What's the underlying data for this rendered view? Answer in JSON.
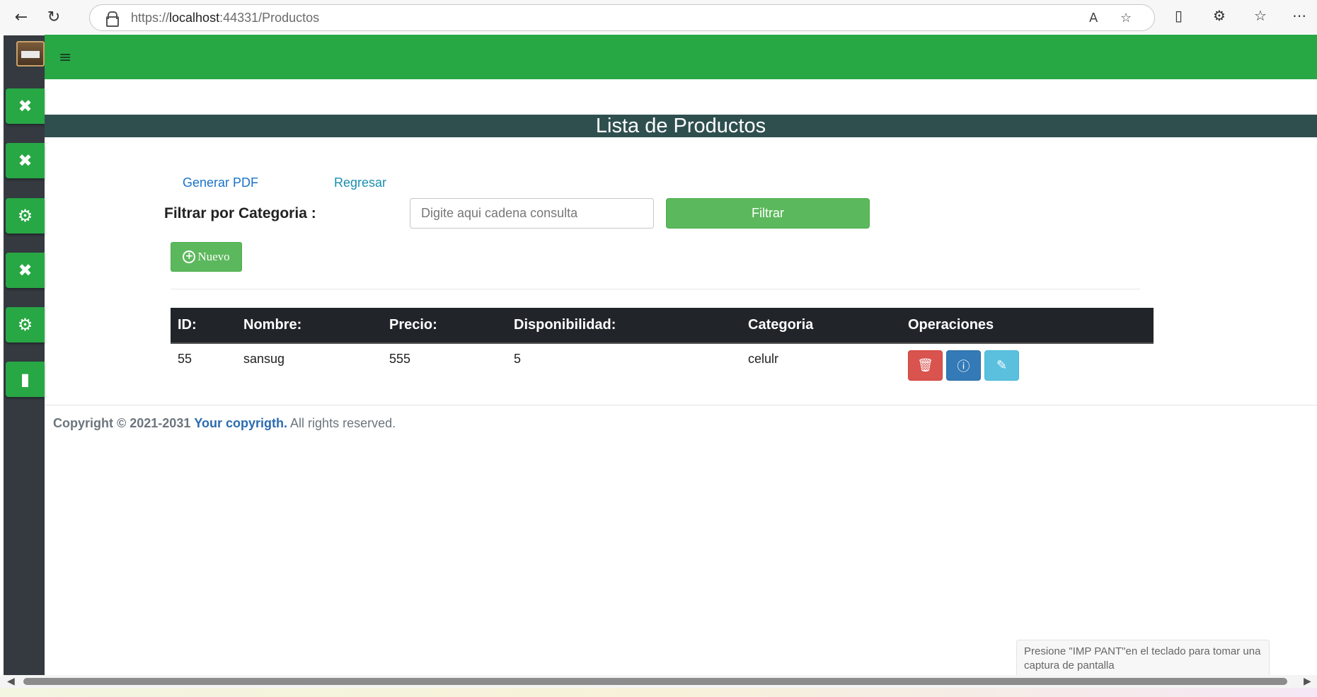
{
  "browser": {
    "url_prefix": "https://",
    "url_host": "localhost",
    "url_rest": ":44331/Productos",
    "icons": [
      "back-icon",
      "refresh-icon",
      "lock-icon",
      "read-aloud-icon",
      "favorite-star-icon",
      "phone-icon",
      "extensions-icon",
      "favorites-icon",
      "more-icon"
    ]
  },
  "sidebar": {
    "items": [
      {
        "icon": "tools-icon",
        "glyph": "✖"
      },
      {
        "icon": "tools-icon",
        "glyph": "✖"
      },
      {
        "icon": "user-gear-icon",
        "glyph": "⚙"
      },
      {
        "icon": "tools-icon",
        "glyph": "✖"
      },
      {
        "icon": "user-gear-icon",
        "glyph": "⚙"
      },
      {
        "icon": "dumbbell-icon",
        "glyph": "▮"
      }
    ]
  },
  "topbar": {
    "menu_glyph": "≡"
  },
  "page": {
    "title": "Lista de Productos",
    "links": {
      "pdf": "Generar PDF",
      "back": "Regresar"
    },
    "filter": {
      "label": "Filtrar por Categoria :",
      "placeholder": "Digite aqui cadena consulta",
      "button": "Filtrar"
    },
    "new_button": "Nuevo"
  },
  "table": {
    "headers": [
      "ID:",
      "Nombre:",
      "Precio:",
      "Disponibilidad:",
      "Categoria",
      "Operaciones"
    ],
    "rows": [
      {
        "id": "55",
        "nombre": "sansug",
        "precio": "555",
        "disponibilidad": "5",
        "categoria": "celulr"
      }
    ]
  },
  "footer": {
    "copyright": "Copyright © 2021-2031",
    "brand": "Your copyrigth.",
    "rights": "All rights reserved."
  },
  "toast": {
    "text": "Presione \"IMP PANT\"en el teclado para tomar una captura de pantalla"
  },
  "colors": {
    "primary_green": "#28a745",
    "title_band": "#2f4f4f",
    "table_header": "#212529",
    "danger": "#d9534f",
    "info": "#337ab7",
    "edit": "#5bc0de"
  }
}
